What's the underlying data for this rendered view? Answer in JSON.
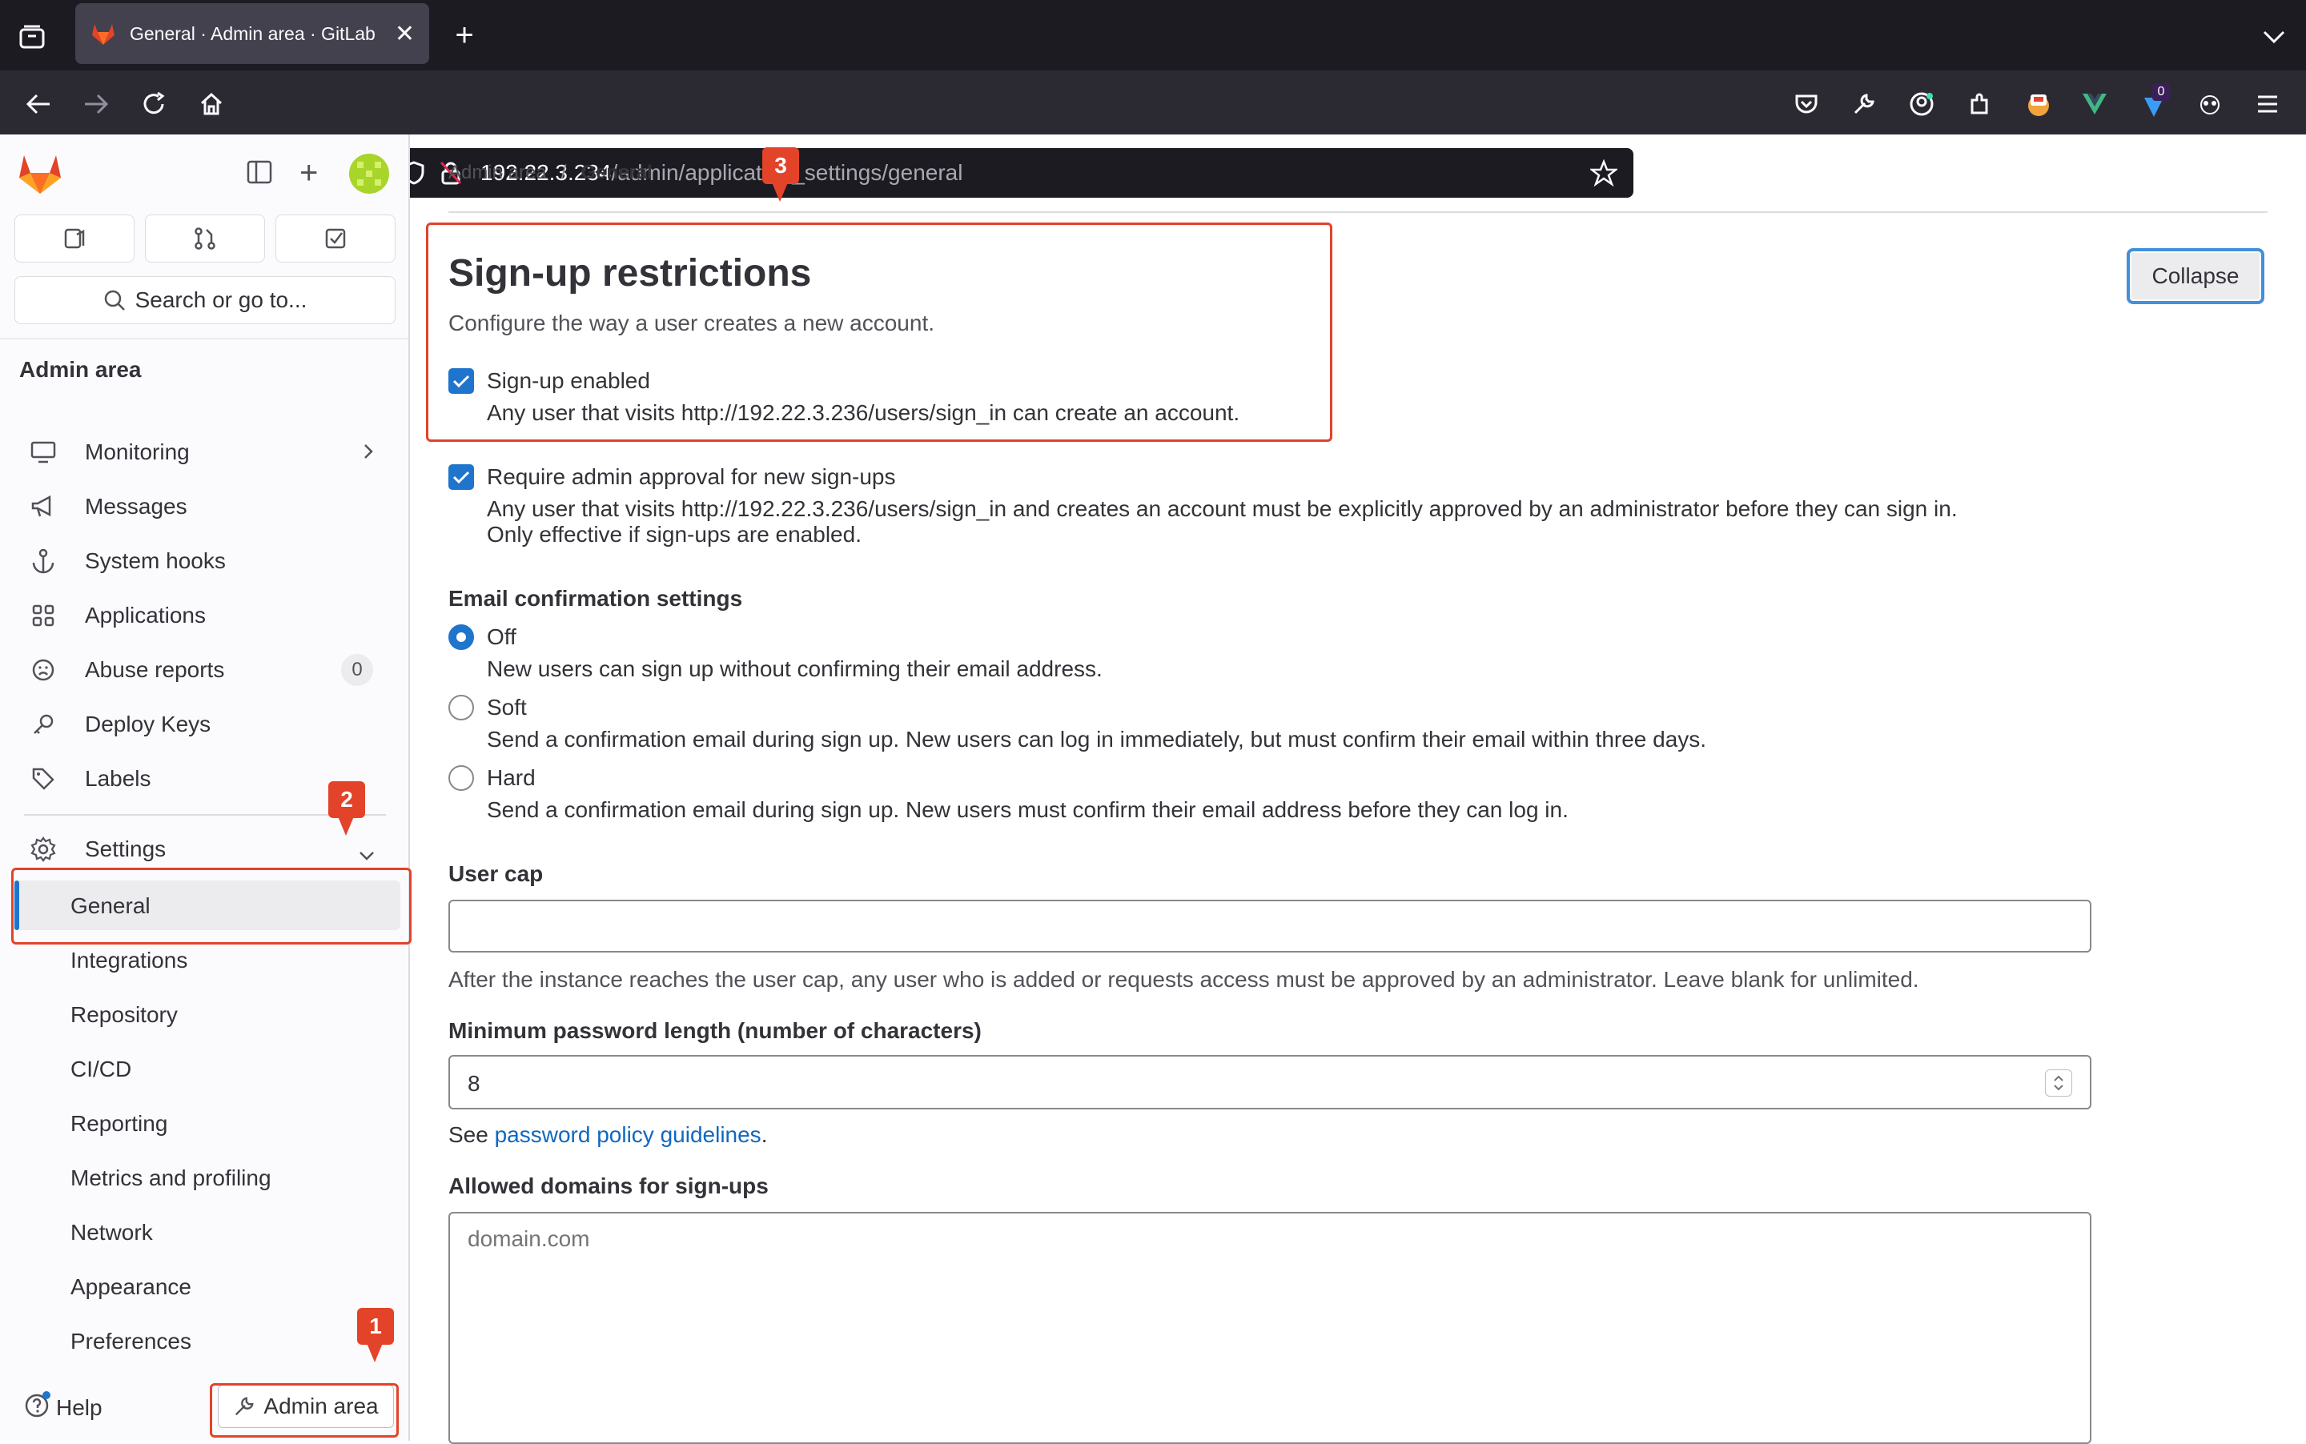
{
  "browser": {
    "tab_title": "General · Admin area · GitLab",
    "url_host": "192.22.3.234",
    "url_path": "/admin/application_settings/general",
    "ext_badge": "0"
  },
  "sidebar": {
    "search_label": "Search or go to...",
    "section_title": "Admin area",
    "items": [
      {
        "label": "Monitoring"
      },
      {
        "label": "Messages"
      },
      {
        "label": "System hooks"
      },
      {
        "label": "Applications"
      },
      {
        "label": "Abuse reports",
        "count": "0"
      },
      {
        "label": "Deploy Keys"
      },
      {
        "label": "Labels"
      },
      {
        "label": "Settings"
      }
    ],
    "settings_sub": [
      "General",
      "Integrations",
      "Repository",
      "CI/CD",
      "Reporting",
      "Metrics and profiling",
      "Network",
      "Appearance",
      "Preferences"
    ],
    "help_label": "Help",
    "admin_button": "Admin area"
  },
  "breadcrumb": {
    "root": "Admin area",
    "sep": "/",
    "current": "General"
  },
  "section": {
    "title": "Sign-up restrictions",
    "description": "Configure the way a user creates a new account.",
    "collapse_label": "Collapse"
  },
  "signup_enabled": {
    "label": "Sign-up enabled",
    "help": "Any user that visits http://192.22.3.236/users/sign_in can create an account."
  },
  "admin_approval": {
    "label": "Require admin approval for new sign-ups",
    "help1": "Any user that visits http://192.22.3.236/users/sign_in and creates an account must be explicitly approved by an administrator before they can sign in.",
    "help2": "Only effective if sign-ups are enabled."
  },
  "email_confirmation": {
    "title": "Email confirmation settings",
    "options": [
      {
        "label": "Off",
        "help": "New users can sign up without confirming their email address.",
        "selected": true
      },
      {
        "label": "Soft",
        "help": "Send a confirmation email during sign up. New users can log in immediately, but must confirm their email within three days.",
        "selected": false
      },
      {
        "label": "Hard",
        "help": "Send a confirmation email during sign up. New users must confirm their email address before they can log in.",
        "selected": false
      }
    ]
  },
  "user_cap": {
    "label": "User cap",
    "value": "",
    "help": "After the instance reaches the user cap, any user who is added or requests access must be approved by an administrator. Leave blank for unlimited."
  },
  "min_password": {
    "label": "Minimum password length (number of characters)",
    "value": "8",
    "help_prefix": "See ",
    "help_link": "password policy guidelines",
    "help_suffix": "."
  },
  "allowed_domains": {
    "label": "Allowed domains for sign-ups",
    "placeholder": "domain.com"
  },
  "annotations": {
    "m1": "1",
    "m2": "2",
    "m3": "3"
  },
  "colors": {
    "accent": "#1f75cb",
    "annotation": "#e24329",
    "sidebar_bg": "#fbfafd"
  }
}
